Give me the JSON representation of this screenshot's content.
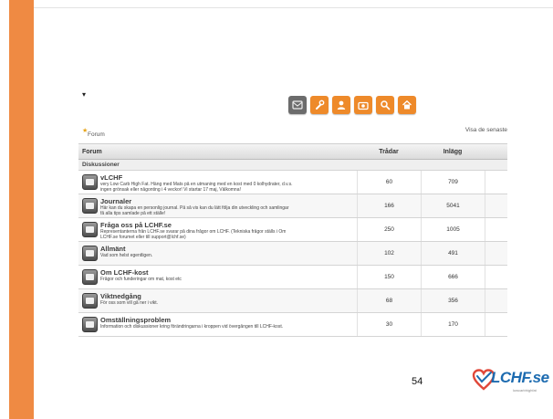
{
  "slide": {
    "page_number": "54",
    "accent_color": "#ef8a43"
  },
  "nav_icons": [
    {
      "name": "forum-icon",
      "glyph": "✉"
    },
    {
      "name": "wrench-icon",
      "glyph": "🔧"
    },
    {
      "name": "user-icon",
      "glyph": "●"
    },
    {
      "name": "camera-icon",
      "glyph": "▣"
    },
    {
      "name": "search-icon",
      "glyph": "⚲"
    },
    {
      "name": "home-icon",
      "glyph": "⌂"
    }
  ],
  "breadcrumb": {
    "label": "Forum"
  },
  "view_link": "Visa de senaste",
  "table": {
    "col_forum": "Forum",
    "col_threads": "Trådar",
    "col_posts": "Inlägg",
    "section": "Diskussioner",
    "rows": [
      {
        "title": "vLCHF",
        "desc1": "very Low Carb High Fat. Häng med Mats på en utmaning med en kost med 0 kolhydrater, d.v.s.",
        "desc2": "ingen grönsak eller någonting i 4 veckor! Vi startar 17 maj, Välkomna!",
        "threads": "60",
        "posts": "709"
      },
      {
        "title": "Journaler",
        "desc1": "Här kan du skapa en personlig journal. På så vis kan du lätt följa din utveckling och samlingar",
        "desc2": "få alla tips samlade på ett ställe!",
        "threads": "166",
        "posts": "5041"
      },
      {
        "title": "Fråga oss på LCHF.se",
        "desc1": "Representanterna från LCHF.se svarar på dina frågor om LCHF. (Tekniska frågor ställs i Om",
        "desc2": "LCHF.se forumet eller till support@lchf.se)",
        "threads": "250",
        "posts": "1005"
      },
      {
        "title": "Allmänt",
        "desc1": "Vad som helst egentligen.",
        "desc2": "",
        "threads": "102",
        "posts": "491"
      },
      {
        "title": "Om LCHF-kost",
        "desc1": "Frågor och funderingar om mat, kost etc",
        "desc2": "",
        "threads": "150",
        "posts": "666"
      },
      {
        "title": "Viktnedgång",
        "desc1": "För oss som vill gå ner i vikt.",
        "desc2": "",
        "threads": "68",
        "posts": "356"
      },
      {
        "title": "Omställningsproblem",
        "desc1": "Information och diskussioner kring förändringarna i kroppen vid övergången till LCHF-kost.",
        "desc2": "",
        "threads": "30",
        "posts": "170"
      }
    ]
  },
  "logo": {
    "text": "LCHF.se",
    "sub": "lowcarbhighfat",
    "brand_color": "#1c6bb0",
    "heart_color": "#e0483a"
  }
}
